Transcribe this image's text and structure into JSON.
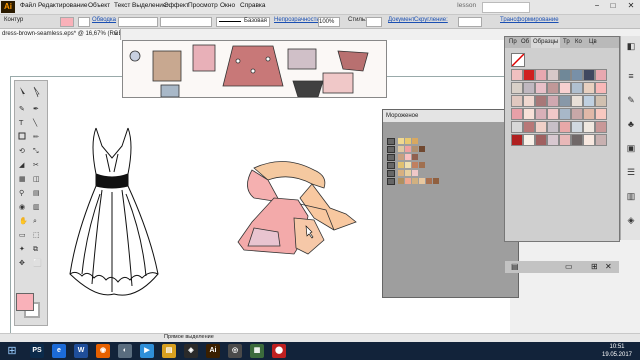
{
  "app": {
    "logo": "Ai"
  },
  "menu": [
    "Файл",
    "Редактирование",
    "Объект",
    "Текст",
    "Выделение",
    "Эффект",
    "Просмотр",
    "Окно",
    "Справка"
  ],
  "workspace": "Iesson",
  "window_controls": [
    "−",
    "□",
    "✕"
  ],
  "control_bar": {
    "stroke_label": "Контур",
    "blend": "Обводка",
    "stroke_style": "Базовая",
    "opacity_label": "Непрозрачность",
    "opacity": "100%",
    "style_label": "Стиль:",
    "document_setup": "Документ",
    "round_corners": "Скругление:",
    "arrange": "Трансформирование"
  },
  "document_tab": {
    "title": "dress-brown-seamless.eps* @ 16,67% (RGB/Просмотр)",
    "close": "×"
  },
  "swatches_panel": {
    "tabs": [
      "Пр",
      "Об",
      "Образцы",
      "Тр",
      "Ко",
      "Цв"
    ],
    "colors": [
      "#f0c0c0",
      "#d02020",
      "#e8a8b0",
      "#d8c8c8",
      "#708898",
      "#7890a8",
      "#404860",
      "#e8a8b0",
      "#d8d0c8",
      "#c0b8c0",
      "#e8c0c8",
      "#c09898",
      "#f8d0d0",
      "#b0c0d0",
      "#e8d0c0",
      "#f8b8b8",
      "#e0c8c0",
      "#f0d8d0",
      "#a87878",
      "#d0a8b0",
      "#8898a8",
      "#e8e0d8",
      "#c0d0e0",
      "#d0c0b0",
      "#e8a0a8",
      "#f8e0d8",
      "#d8b0b8",
      "#f0c8c8",
      "#a8b8c8",
      "#c8a8a8",
      "#e0b8a8",
      "#f8c8c0",
      "#d8d8d8",
      "#b87878",
      "#f0d0c8",
      "#c8c0c8",
      "#e8a8a8",
      "#d0d8e0",
      "#f0e8e0",
      "#c89898",
      "#b02020",
      "#f8f0e8",
      "#a06060",
      "#d8c8d0",
      "#e8b8b8",
      "#706868",
      "#f8e8e0",
      "#c8b0b0"
    ]
  },
  "icecream_panel": {
    "title": "Мороженое",
    "rows": [
      [
        "#f0d890",
        "#e8c870",
        "#d8a860"
      ],
      [
        "#e0c8a0",
        "#f0a0a0",
        "#b09070",
        "#704830"
      ],
      [
        "#c8a080",
        "#f8c0c0",
        "#906050"
      ],
      [
        "#e0c070",
        "#f0e0b0",
        "#c08060",
        "#a07050"
      ],
      [
        "#d8b080",
        "#e8d0a0",
        "#f0c8c8"
      ],
      [
        "#b09060",
        "#f0a890",
        "#d0b080",
        "#e8c8a0",
        "#a87050",
        "#906040"
      ]
    ]
  },
  "status": "Прямое выделение",
  "taskbar": {
    "apps": [
      {
        "label": "PS",
        "color": "#0b2a4a"
      },
      {
        "label": "e",
        "color": "#1c6bd8"
      },
      {
        "label": "W",
        "color": "#1f4e9a"
      },
      {
        "label": "◉",
        "color": "#e66000"
      },
      {
        "label": "◐",
        "color": "#5a6d7f"
      },
      {
        "label": "▶",
        "color": "#2f8fd8"
      },
      {
        "label": "▤",
        "color": "#d8a020"
      },
      {
        "label": "◈",
        "color": "#2a2a2a"
      },
      {
        "label": "Ai",
        "color": "#3a1f00"
      },
      {
        "label": "◎",
        "color": "#4a4a4a"
      },
      {
        "label": "▦",
        "color": "#3c6b3c"
      },
      {
        "label": "⬤",
        "color": "#c02020"
      }
    ],
    "time": "10:51",
    "date": "19.05.2017"
  }
}
